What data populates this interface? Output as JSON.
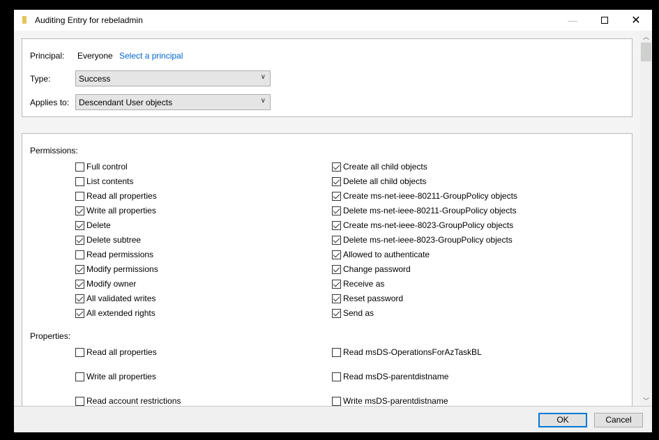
{
  "window": {
    "title": "Auditing Entry for rebeladmin",
    "icons": [
      "folder-icon",
      "minimize-icon",
      "maximize-icon",
      "close-icon"
    ]
  },
  "header": {
    "principal_label": "Principal:",
    "principal_value": "Everyone",
    "select_principal": "Select a principal",
    "type_label": "Type:",
    "type_value": "Success",
    "applies_label": "Applies to:",
    "applies_value": "Descendant User objects"
  },
  "permissions": {
    "label": "Permissions:",
    "left": [
      {
        "label": "Full control",
        "checked": false
      },
      {
        "label": "List contents",
        "checked": false
      },
      {
        "label": "Read all properties",
        "checked": false
      },
      {
        "label": "Write all properties",
        "checked": true
      },
      {
        "label": "Delete",
        "checked": true
      },
      {
        "label": "Delete subtree",
        "checked": true
      },
      {
        "label": "Read permissions",
        "checked": false
      },
      {
        "label": "Modify permissions",
        "checked": true
      },
      {
        "label": "Modify owner",
        "checked": true
      },
      {
        "label": "All validated writes",
        "checked": true
      },
      {
        "label": "All extended rights",
        "checked": true
      }
    ],
    "right": [
      {
        "label": "Create all child objects",
        "checked": true
      },
      {
        "label": "Delete all child objects",
        "checked": true
      },
      {
        "label": "Create ms-net-ieee-80211-GroupPolicy objects",
        "checked": true
      },
      {
        "label": "Delete ms-net-ieee-80211-GroupPolicy objects",
        "checked": true
      },
      {
        "label": "Create ms-net-ieee-8023-GroupPolicy objects",
        "checked": true
      },
      {
        "label": "Delete ms-net-ieee-8023-GroupPolicy objects",
        "checked": true
      },
      {
        "label": "Allowed to authenticate",
        "checked": true
      },
      {
        "label": "Change password",
        "checked": true
      },
      {
        "label": "Receive as",
        "checked": true
      },
      {
        "label": "Reset password",
        "checked": true
      },
      {
        "label": "Send as",
        "checked": true
      }
    ]
  },
  "properties": {
    "label": "Properties:",
    "left": [
      {
        "label": "Read all properties",
        "checked": false
      },
      {
        "label": "Write all properties",
        "checked": false
      },
      {
        "label": "Read account restrictions",
        "checked": false
      }
    ],
    "right": [
      {
        "label": "Read msDS-OperationsForAzTaskBL",
        "checked": false
      },
      {
        "label": "Read msDS-parentdistname",
        "checked": false
      },
      {
        "label": "Write msDS-parentdistname",
        "checked": false
      }
    ]
  },
  "footer": {
    "ok": "OK",
    "cancel": "Cancel"
  }
}
